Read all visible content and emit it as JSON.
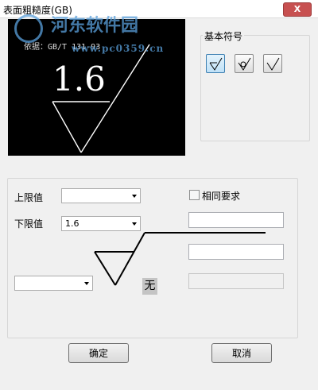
{
  "window": {
    "title": "表面粗糙度(GB)",
    "close_label": "X"
  },
  "watermark": {
    "line1": "河东软件园",
    "line2": "www.pc0359.cn"
  },
  "preview": {
    "standard": "依据：GB/T 131-93",
    "value": "1.6"
  },
  "basic_symbols": {
    "label": "基本符号"
  },
  "upper_limit": {
    "label": "上限值",
    "value": ""
  },
  "lower_limit": {
    "label": "下限值",
    "value": "1.6"
  },
  "same_requirement": {
    "label": "相同要求",
    "checked": false
  },
  "surface_mark": {
    "wu_label": "无"
  },
  "buttons": {
    "ok": "确定",
    "cancel": "取消"
  }
}
